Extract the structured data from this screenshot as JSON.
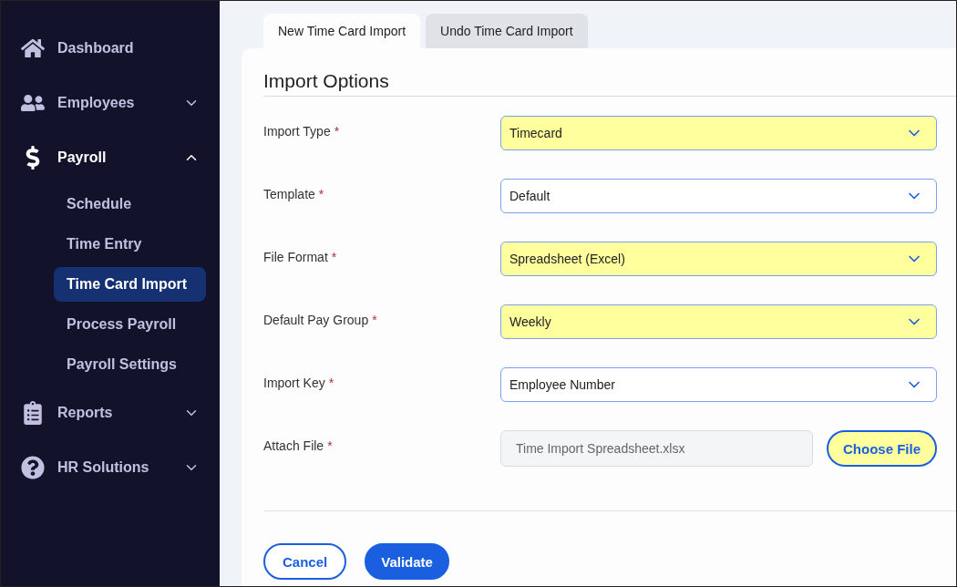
{
  "sidebar": {
    "items": [
      {
        "kind": "link",
        "label": "Dashboard"
      },
      {
        "kind": "group",
        "label": "Employees",
        "expanded": false
      },
      {
        "kind": "group",
        "label": "Payroll",
        "expanded": true,
        "children": [
          {
            "label": "Schedule",
            "selected": false
          },
          {
            "label": "Time Entry",
            "selected": false
          },
          {
            "label": "Time Card Import",
            "selected": true
          },
          {
            "label": "Process Payroll",
            "selected": false
          },
          {
            "label": "Payroll Settings",
            "selected": false
          }
        ]
      },
      {
        "kind": "group",
        "label": "Reports",
        "expanded": false
      },
      {
        "kind": "group",
        "label": "HR Solutions",
        "expanded": false
      }
    ]
  },
  "tabs": [
    {
      "label": "New Time Card Import",
      "selected": true
    },
    {
      "label": "Undo Time Card Import",
      "selected": false
    }
  ],
  "form": {
    "title": "Import Options",
    "fields": [
      {
        "kind": "select",
        "label": "Import Type",
        "required_mark": "*",
        "value": "Timecard",
        "highlighted": true
      },
      {
        "kind": "select",
        "label": "Template",
        "required_mark": "*",
        "value": "Default",
        "highlighted": false
      },
      {
        "kind": "select",
        "label": "File Format",
        "required_mark": "*",
        "value": "Spreadsheet (Excel)",
        "highlighted": true
      },
      {
        "kind": "select",
        "label": "Default Pay Group",
        "required_mark": "*",
        "value": "Weekly",
        "highlighted": true
      },
      {
        "kind": "select",
        "label": "Import Key",
        "required_mark": "*",
        "value": "Employee Number",
        "highlighted": false
      },
      {
        "kind": "file",
        "label": "Attach File",
        "required_mark": "*",
        "value": "Time Import Spreadsheet.xlsx",
        "button": "Choose File",
        "highlighted": true
      }
    ]
  },
  "buttons": [
    {
      "kind": "secondary",
      "label": "Cancel"
    },
    {
      "kind": "primary",
      "label": "Validate"
    }
  ]
}
